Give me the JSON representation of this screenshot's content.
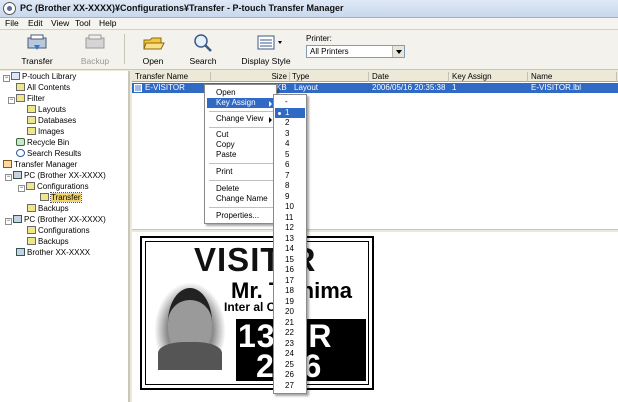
{
  "window": {
    "title": "PC (Brother XX-XXXX)¥Configurations¥Transfer - P-touch Transfer Manager"
  },
  "menu": [
    "File",
    "Edit",
    "View",
    "Tool",
    "Help"
  ],
  "toolbar": {
    "transfer": "Transfer",
    "backup": "Backup",
    "open": "Open",
    "search": "Search",
    "display_style": "Display Style",
    "printer_label": "Printer:",
    "printer_value": "All Printers"
  },
  "tree": [
    "P-touch Library",
    "All Contents",
    "Filter",
    "Layouts",
    "Databases",
    "Images",
    "Recycle Bin",
    "Search Results",
    "Transfer Manager",
    "PC (Brother XX-XXXX)",
    "Configurations",
    "Transfer",
    "Backups",
    "PC (Brother XX-XXXX)",
    "Configurations",
    "Backups",
    "Brother XX-XXXX"
  ],
  "list": {
    "headers": [
      "Transfer Name",
      "Size",
      "Type",
      "Date",
      "Key Assign",
      "Name"
    ],
    "row": {
      "name": "E-VISITOR",
      "size": "KB",
      "type": "Layout",
      "date": "2006/05/16 20:35:38",
      "key": "1",
      "file": "E-VISITOR.lbl"
    }
  },
  "preview": {
    "heading": "VISIT R",
    "name": "Mr. T   shima",
    "corp": "Inter        al Corp",
    "date1": "13    AR",
    "date2": "2  06"
  },
  "context_menu": [
    "Open",
    "Key Assign",
    "Change View",
    "Cut",
    "Copy",
    "Paste",
    "Print",
    "Delete",
    "Change Name",
    "Properties..."
  ],
  "key_assign": [
    "-",
    "1",
    "2",
    "3",
    "4",
    "5",
    "6",
    "7",
    "8",
    "9",
    "10",
    "11",
    "12",
    "13",
    "14",
    "15",
    "16",
    "17",
    "18",
    "19",
    "20",
    "21",
    "22",
    "23",
    "24",
    "25",
    "26",
    "27"
  ],
  "colors": {
    "highlight": "#316ac5",
    "chrome": "#ece9d8"
  }
}
